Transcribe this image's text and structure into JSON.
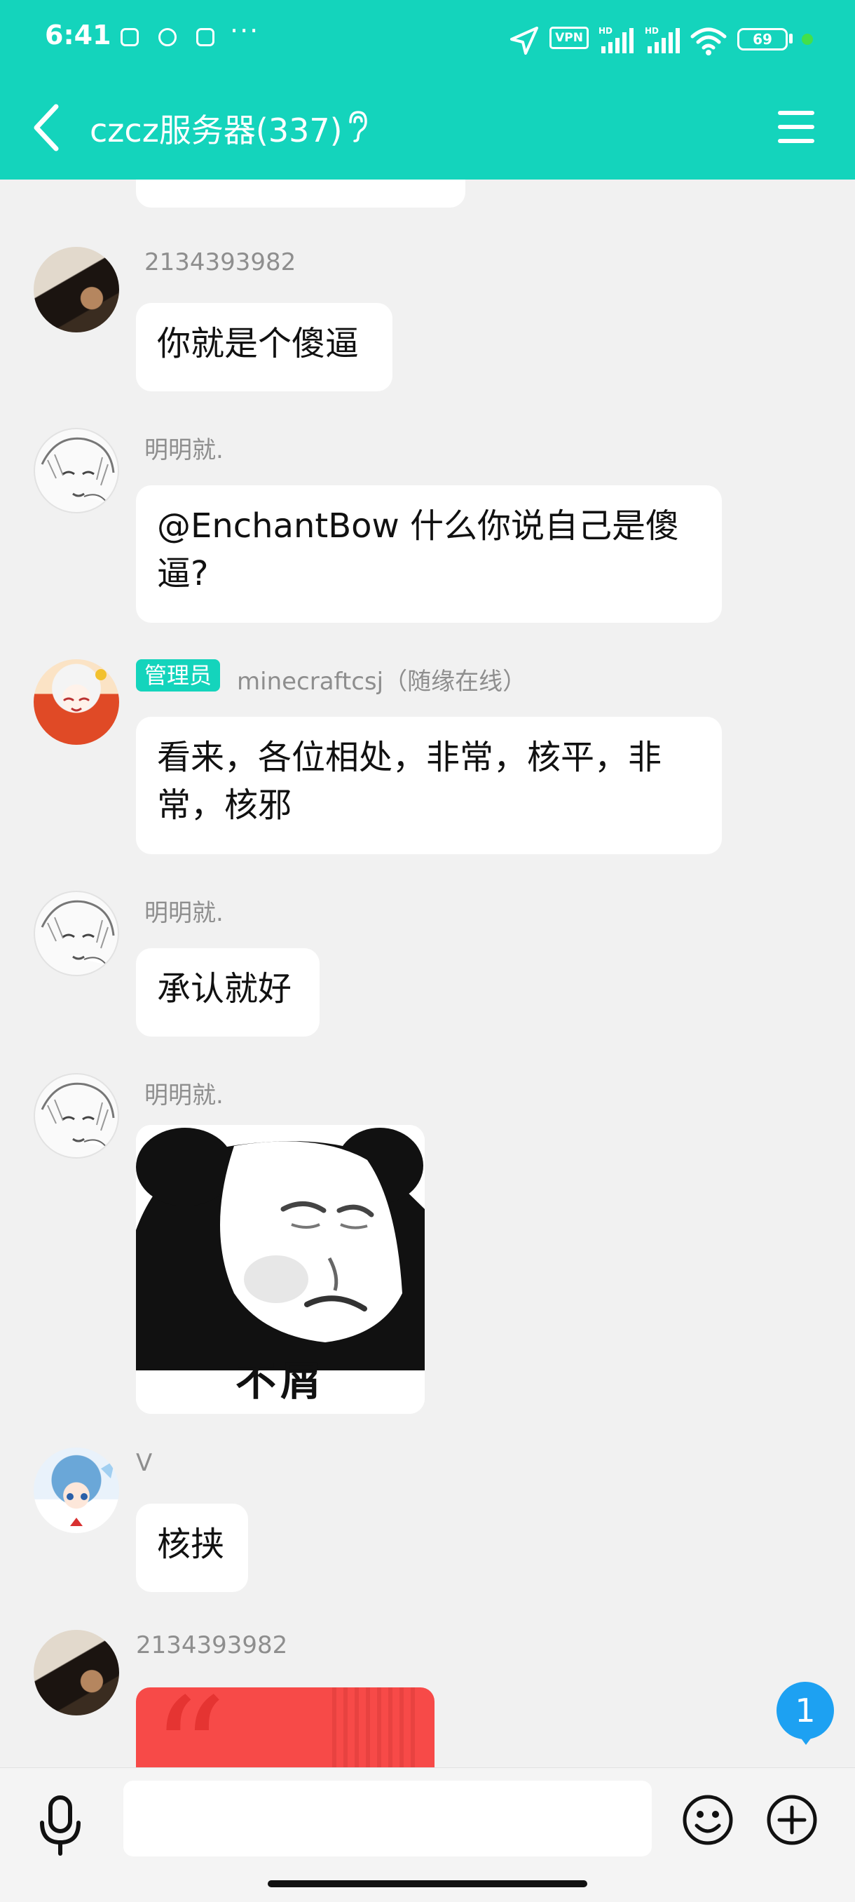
{
  "status_bar": {
    "time": "6:41",
    "more": "···",
    "vpn": "VPN",
    "battery": "69",
    "signal_label": "HD"
  },
  "header": {
    "title": "czcz服务器(337)",
    "back_icon": "chevron-left-icon",
    "ear_icon": "ear-icon",
    "menu_icon": "hamburger-menu-icon"
  },
  "messages": [
    {
      "sender": "2134393982",
      "avatar": "photo-avatar",
      "text": "你就是个傻逼"
    },
    {
      "sender": "明明就.",
      "avatar": "sketch-avatar",
      "text_line1": "@EnchantBow 什么你说自己是傻",
      "text_line2": "逼?"
    },
    {
      "badge": "管理员",
      "sender": "minecraftcsj（随缘在线）",
      "avatar": "anime-red-avatar",
      "text_line1": "看来，各位相处，非常，核平，非",
      "text_line2": "常，核邪"
    },
    {
      "sender": "明明就.",
      "avatar": "sketch-avatar",
      "text": "承认就好"
    },
    {
      "sender": "明明就.",
      "avatar": "sketch-avatar",
      "sticker_caption": "不屑"
    },
    {
      "sender": "V",
      "avatar": "anime-blue-avatar",
      "text": "核挟"
    },
    {
      "sender": "2134393982",
      "avatar": "photo-avatar",
      "card": "red-quote-card"
    }
  ],
  "unread_count": "1",
  "input": {
    "placeholder": "",
    "mic_icon": "microphone-icon",
    "emoji_icon": "smiley-icon",
    "plus_icon": "plus-circle-icon"
  },
  "colors": {
    "accent": "#14d4bc",
    "unread": "#1da1f2",
    "card_red": "#f74a48"
  }
}
